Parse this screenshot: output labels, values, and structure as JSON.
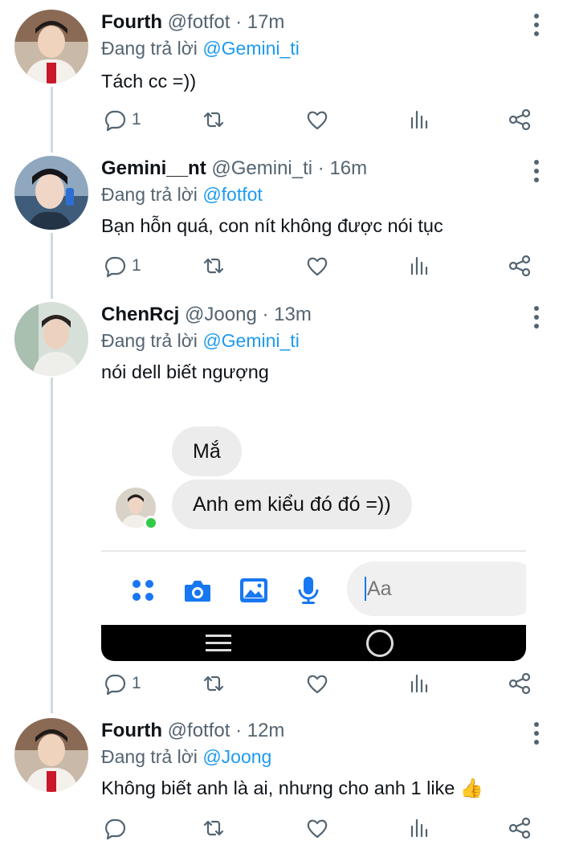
{
  "reply_prefix": "Đang trả lời",
  "tweets": [
    {
      "name": "Fourth",
      "handle": "@fotfot",
      "time": "17m",
      "reply_to": "@Gemini_ti",
      "text": "Tách cc =))",
      "reply_count": "1"
    },
    {
      "name": "Gemini__nt",
      "handle": "@Gemini_ti",
      "time": "16m",
      "reply_to": "@fotfot",
      "text": "Bạn hỗn quá, con nít không được nói tục",
      "reply_count": "1"
    },
    {
      "name": "ChenRcj",
      "handle": "@Joong",
      "time": "13m",
      "reply_to": "@Gemini_ti",
      "text": "nói dell biết ngượng",
      "reply_count": "1",
      "embedded_chat": {
        "messages": [
          "Mắ",
          "Anh em kiểu đó đó =))"
        ],
        "composer_placeholder": "Aa",
        "composer_icons": [
          "apps-icon",
          "camera-icon",
          "image-icon",
          "mic-icon"
        ]
      }
    },
    {
      "name": "Fourth",
      "handle": "@fotfot",
      "time": "12m",
      "reply_to": "@Joong",
      "text": "Không biết anh là ai, nhưng cho anh 1 like 👍",
      "reply_count": ""
    }
  ],
  "colors": {
    "mention": "#1d9bf0",
    "secondary_text": "#536471",
    "thread_line": "#cfd9de",
    "messenger_blue": "#1877f2",
    "online_green": "#31cc46"
  }
}
